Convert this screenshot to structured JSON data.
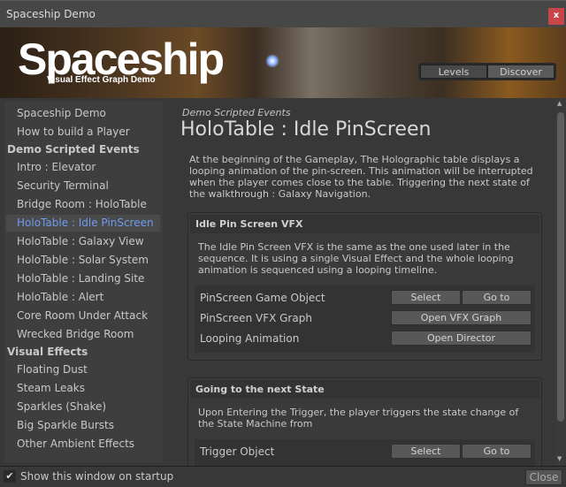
{
  "window": {
    "title": "Spaceship Demo",
    "close_glyph": "x"
  },
  "banner": {
    "logo": "Spaceship",
    "subtitle": "Visual Effect Graph Demo",
    "tabs": [
      "Levels",
      "Discover"
    ],
    "selected_tab": "Discover"
  },
  "sidebar": {
    "groups": [
      {
        "header": null,
        "items": [
          "Spaceship Demo",
          "How to build a Player"
        ]
      },
      {
        "header": "Demo Scripted Events",
        "items": [
          "Intro : Elevator",
          "Security Terminal",
          "Bridge Room : HoloTable",
          "HoloTable : Idle PinScreen",
          "HoloTable : Galaxy View",
          "HoloTable : Solar System",
          "HoloTable : Landing Site",
          "HoloTable : Alert",
          "Core Room Under Attack",
          "Wrecked Bridge Room"
        ]
      },
      {
        "header": "Visual Effects",
        "items": [
          "Floating Dust",
          "Steam Leaks",
          "Sparkles (Shake)",
          "Big Sparkle Bursts",
          "Other Ambient Effects"
        ]
      }
    ],
    "selected": "HoloTable : Idle PinScreen",
    "selected_color": "#6f9bf0"
  },
  "main": {
    "breadcrumb": "Demo Scripted Events",
    "title": "HoloTable : Idle PinScreen",
    "intro": "At the beginning of the Gameplay, The Holographic table displays a looping animation of the pin-screen. This animation will be interrupted when the player comes close to the table. Triggering the next state of the walkthrough : Galaxy Navigation.",
    "sections": [
      {
        "title": "Idle Pin Screen VFX",
        "text": "The Idle Pin Screen VFX is the same as the one used later in the sequence. It is using a single Visual Effect and the whole looping animation is sequenced using a looping timeline.",
        "rows": [
          {
            "label": "PinScreen Game Object",
            "buttons": [
              "Select",
              "Go to"
            ]
          },
          {
            "label": "PinScreen VFX Graph",
            "buttons": [
              "Open VFX Graph"
            ]
          },
          {
            "label": "Looping Animation",
            "buttons": [
              "Open Director"
            ]
          }
        ]
      },
      {
        "title": "Going to the next State",
        "text": "Upon Entering the Trigger, the player triggers the state change of the State Machine from",
        "rows": [
          {
            "label": "Trigger Object",
            "buttons": [
              "Select",
              "Go to"
            ]
          }
        ]
      }
    ]
  },
  "footer": {
    "show_on_startup_label": "Show this window on startup",
    "show_on_startup_checked": true,
    "close_label": "Close"
  }
}
